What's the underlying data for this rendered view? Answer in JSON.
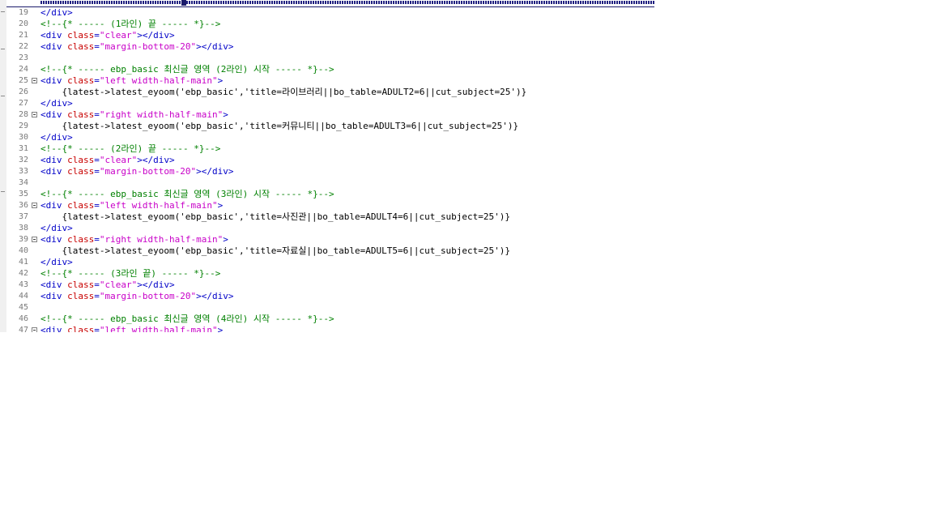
{
  "editor": {
    "lines": [
      {
        "num": "19",
        "fold": false,
        "parts": [
          {
            "t": "tag",
            "v": "</div>"
          }
        ]
      },
      {
        "num": "20",
        "fold": false,
        "parts": [
          {
            "t": "cmt",
            "v": "<!--{* ----- (1라인) 끝 ----- *}-->"
          }
        ]
      },
      {
        "num": "21",
        "fold": false,
        "parts": [
          {
            "t": "tag",
            "v": "<div "
          },
          {
            "t": "attr",
            "v": "class"
          },
          {
            "t": "tag",
            "v": "="
          },
          {
            "t": "str",
            "v": "\"clear\""
          },
          {
            "t": "tag",
            "v": "></div>"
          }
        ]
      },
      {
        "num": "22",
        "fold": false,
        "parts": [
          {
            "t": "tag",
            "v": "<div "
          },
          {
            "t": "attr",
            "v": "class"
          },
          {
            "t": "tag",
            "v": "="
          },
          {
            "t": "str",
            "v": "\"margin-bottom-20\""
          },
          {
            "t": "tag",
            "v": "></div>"
          }
        ]
      },
      {
        "num": "23",
        "fold": false,
        "parts": []
      },
      {
        "num": "24",
        "fold": false,
        "parts": [
          {
            "t": "cmt",
            "v": "<!--{* ----- ebp_basic 최신글 영역 (2라인) 시작 ----- *}-->"
          }
        ]
      },
      {
        "num": "25",
        "fold": true,
        "parts": [
          {
            "t": "tag",
            "v": "<div "
          },
          {
            "t": "attr",
            "v": "class"
          },
          {
            "t": "tag",
            "v": "="
          },
          {
            "t": "str",
            "v": "\"left width-half-main\""
          },
          {
            "t": "tag",
            "v": ">"
          }
        ]
      },
      {
        "num": "26",
        "fold": false,
        "parts": [
          {
            "t": "txt",
            "v": "    {latest->latest_eyoom('ebp_basic','title=라이브러리||bo_table=ADULT2=6||cut_subject=25')}"
          }
        ]
      },
      {
        "num": "27",
        "fold": false,
        "parts": [
          {
            "t": "tag",
            "v": "</div>"
          }
        ]
      },
      {
        "num": "28",
        "fold": true,
        "parts": [
          {
            "t": "tag",
            "v": "<div "
          },
          {
            "t": "attr",
            "v": "class"
          },
          {
            "t": "tag",
            "v": "="
          },
          {
            "t": "str",
            "v": "\"right width-half-main\""
          },
          {
            "t": "tag",
            "v": ">"
          }
        ]
      },
      {
        "num": "29",
        "fold": false,
        "parts": [
          {
            "t": "txt",
            "v": "    {latest->latest_eyoom('ebp_basic','title=커뮤니티||bo_table=ADULT3=6||cut_subject=25')}"
          }
        ]
      },
      {
        "num": "30",
        "fold": false,
        "parts": [
          {
            "t": "tag",
            "v": "</div>"
          }
        ]
      },
      {
        "num": "31",
        "fold": false,
        "parts": [
          {
            "t": "cmt",
            "v": "<!--{* ----- (2라인) 끝 ----- *}-->"
          }
        ]
      },
      {
        "num": "32",
        "fold": false,
        "parts": [
          {
            "t": "tag",
            "v": "<div "
          },
          {
            "t": "attr",
            "v": "class"
          },
          {
            "t": "tag",
            "v": "="
          },
          {
            "t": "str",
            "v": "\"clear\""
          },
          {
            "t": "tag",
            "v": "></div>"
          }
        ]
      },
      {
        "num": "33",
        "fold": false,
        "parts": [
          {
            "t": "tag",
            "v": "<div "
          },
          {
            "t": "attr",
            "v": "class"
          },
          {
            "t": "tag",
            "v": "="
          },
          {
            "t": "str",
            "v": "\"margin-bottom-20\""
          },
          {
            "t": "tag",
            "v": "></div>"
          }
        ]
      },
      {
        "num": "34",
        "fold": false,
        "parts": []
      },
      {
        "num": "35",
        "fold": false,
        "parts": [
          {
            "t": "cmt",
            "v": "<!--{* ----- ebp_basic 최신글 영역 (3라인) 시작 ----- *}-->"
          }
        ]
      },
      {
        "num": "36",
        "fold": true,
        "parts": [
          {
            "t": "tag",
            "v": "<div "
          },
          {
            "t": "attr",
            "v": "class"
          },
          {
            "t": "tag",
            "v": "="
          },
          {
            "t": "str",
            "v": "\"left width-half-main\""
          },
          {
            "t": "tag",
            "v": ">"
          }
        ]
      },
      {
        "num": "37",
        "fold": false,
        "parts": [
          {
            "t": "txt",
            "v": "    {latest->latest_eyoom('ebp_basic','title=사진관||bo_table=ADULT4=6||cut_subject=25')}"
          }
        ]
      },
      {
        "num": "38",
        "fold": false,
        "parts": [
          {
            "t": "tag",
            "v": "</div>"
          }
        ]
      },
      {
        "num": "39",
        "fold": true,
        "parts": [
          {
            "t": "tag",
            "v": "<div "
          },
          {
            "t": "attr",
            "v": "class"
          },
          {
            "t": "tag",
            "v": "="
          },
          {
            "t": "str",
            "v": "\"right width-half-main\""
          },
          {
            "t": "tag",
            "v": ">"
          }
        ]
      },
      {
        "num": "40",
        "fold": false,
        "parts": [
          {
            "t": "txt",
            "v": "    {latest->latest_eyoom('ebp_basic','title=자료실||bo_table=ADULT5=6||cut_subject=25')}"
          }
        ]
      },
      {
        "num": "41",
        "fold": false,
        "parts": [
          {
            "t": "tag",
            "v": "</div>"
          }
        ]
      },
      {
        "num": "42",
        "fold": false,
        "parts": [
          {
            "t": "cmt",
            "v": "<!--{* ----- (3라인 끝) ----- *}-->"
          }
        ]
      },
      {
        "num": "43",
        "fold": false,
        "parts": [
          {
            "t": "tag",
            "v": "<div "
          },
          {
            "t": "attr",
            "v": "class"
          },
          {
            "t": "tag",
            "v": "="
          },
          {
            "t": "str",
            "v": "\"clear\""
          },
          {
            "t": "tag",
            "v": "></div>"
          }
        ]
      },
      {
        "num": "44",
        "fold": false,
        "parts": [
          {
            "t": "tag",
            "v": "<div "
          },
          {
            "t": "attr",
            "v": "class"
          },
          {
            "t": "tag",
            "v": "="
          },
          {
            "t": "str",
            "v": "\"margin-bottom-20\""
          },
          {
            "t": "tag",
            "v": "></div>"
          }
        ]
      },
      {
        "num": "45",
        "fold": false,
        "parts": []
      },
      {
        "num": "46",
        "fold": false,
        "parts": [
          {
            "t": "cmt",
            "v": "<!--{* ----- ebp_basic 최신글 영역 (4라인) 시작 ----- *}-->"
          }
        ]
      },
      {
        "num": "47",
        "fold": true,
        "parts": [
          {
            "t": "tag",
            "v": "<div "
          },
          {
            "t": "attr",
            "v": "class"
          },
          {
            "t": "tag",
            "v": "="
          },
          {
            "t": "str",
            "v": "\"left width-half-main\""
          },
          {
            "t": "tag",
            "v": ">"
          }
        ]
      }
    ]
  },
  "colors": {
    "tag": "#0000c8",
    "attribute": "#c80000",
    "string": "#c800c8",
    "comment": "#008000",
    "line_number": "#7a7a7a"
  }
}
